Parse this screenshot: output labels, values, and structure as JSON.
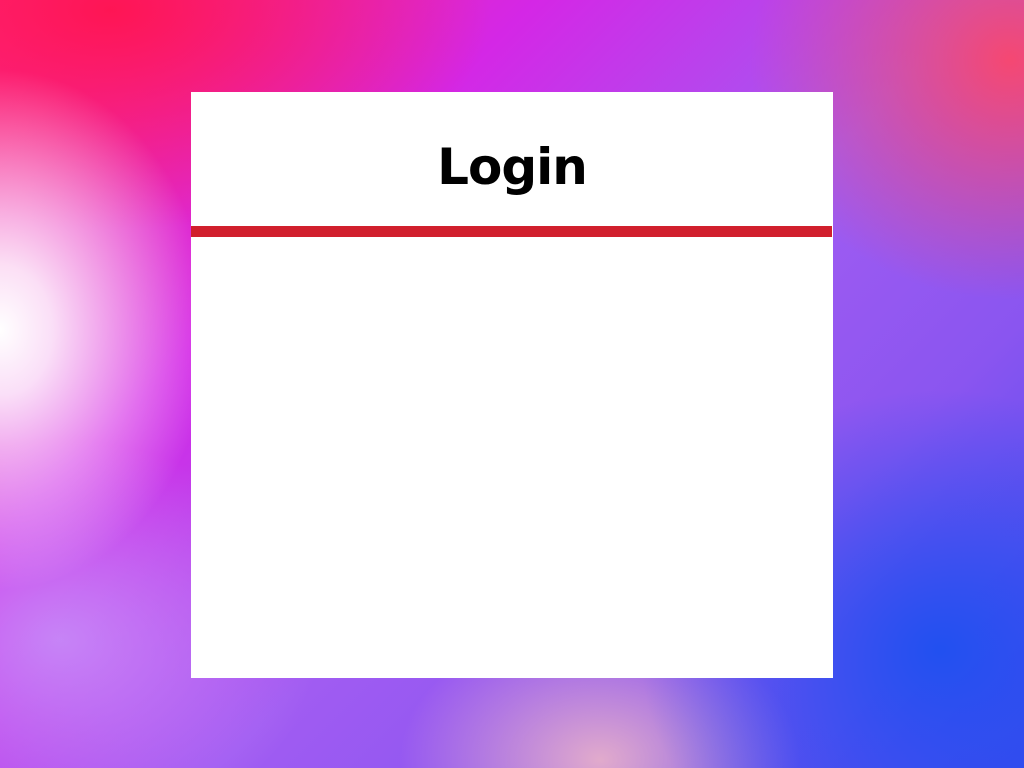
{
  "login": {
    "title": "Login"
  },
  "colors": {
    "panel_background": "#ffffff",
    "divider": "#d11f2d",
    "title_text": "#000000"
  }
}
